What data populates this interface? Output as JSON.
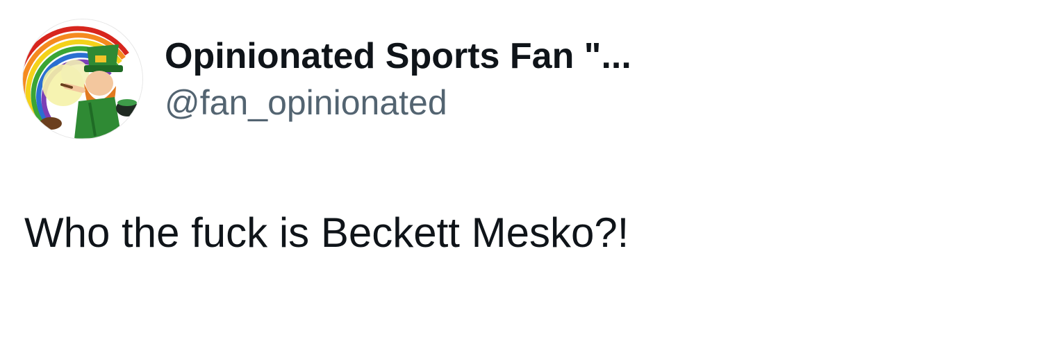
{
  "tweet": {
    "author": {
      "display_name": "Opinionated Sports Fan \"...",
      "handle": "@fan_opinionated",
      "avatar_icon": "leprechaun-rainbow-avatar"
    },
    "text": "Who the fuck is Beckett Mesko?!"
  },
  "colors": {
    "background": "#ffffff",
    "primary_text": "#0f1419",
    "secondary_text": "#536471"
  }
}
